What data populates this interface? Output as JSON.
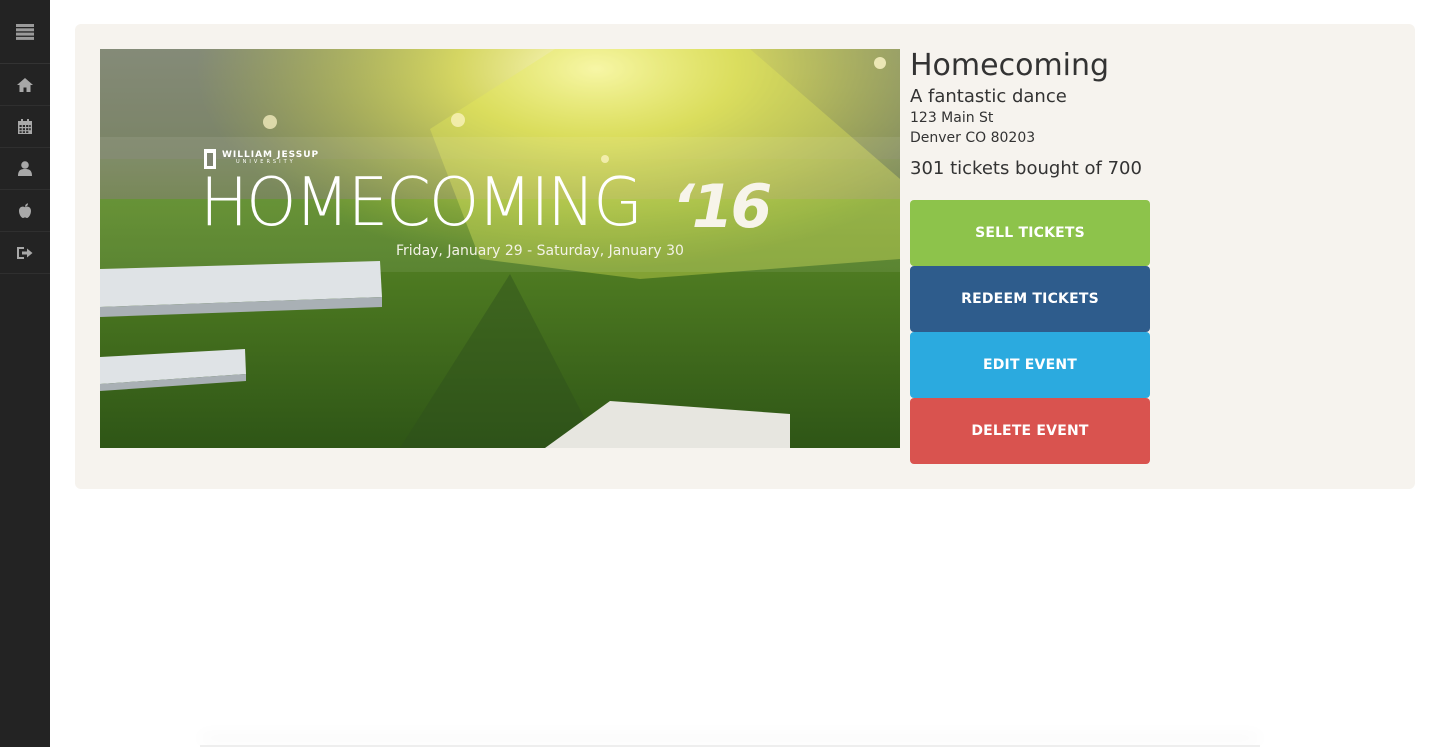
{
  "sidebar": {
    "items": [
      {
        "icon": "menu-icon"
      },
      {
        "icon": "home-icon"
      },
      {
        "icon": "calendar-icon"
      },
      {
        "icon": "user-icon"
      },
      {
        "icon": "apple-icon"
      },
      {
        "icon": "logout-icon"
      }
    ]
  },
  "banner": {
    "university": "WILLIAM JESSUP",
    "university_sub": "UNIVERSITY",
    "title": "HOMECOMING",
    "year": "‘16",
    "dates": "Friday, January 29 - Saturday, January 30"
  },
  "event": {
    "title": "Homecoming",
    "subtitle": "A fantastic dance",
    "address_line1": "123 Main St",
    "address_line2": "Denver CO 80203",
    "tickets_text": "301 tickets bought of 700"
  },
  "actions": {
    "sell": "SELL TICKETS",
    "redeem": "REDEEM TICKETS",
    "edit": "EDIT EVENT",
    "delete": "DELETE EVENT"
  },
  "colors": {
    "sidebar_bg": "#232323",
    "card_bg": "#f6f3ee",
    "sell": "#8dc34b",
    "redeem": "#2e5c8c",
    "edit": "#2baadf",
    "delete": "#d9534f"
  }
}
